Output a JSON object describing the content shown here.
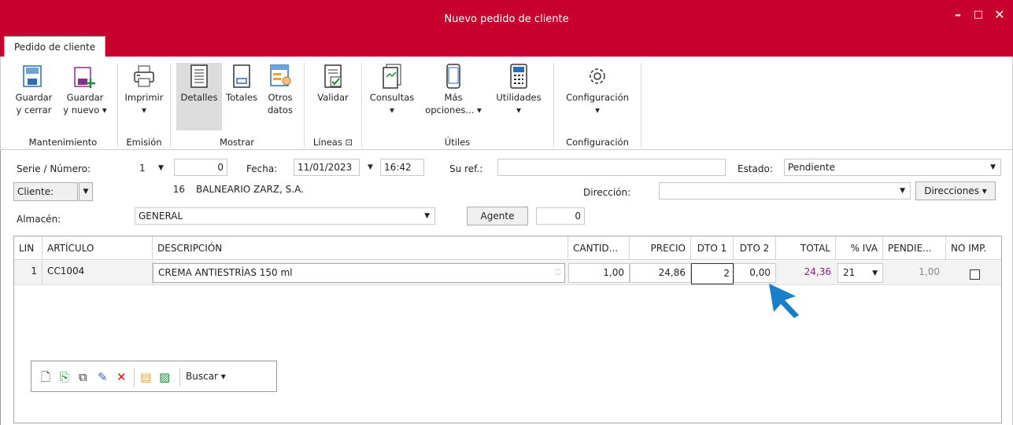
{
  "window": {
    "title": "Nuevo pedido de cliente",
    "minimize": "–",
    "maximize": "□",
    "close": "✕"
  },
  "tab": {
    "label": "Pedido de cliente"
  },
  "ribbon": {
    "guardar_cerrar": [
      "Guardar",
      "y cerrar"
    ],
    "guardar_nuevo": [
      "Guardar",
      "y nuevo ▾"
    ],
    "imprimir": [
      "Imprimir",
      "▾"
    ],
    "detalles": "Detalles",
    "totales": "Totales",
    "otros": [
      "Otros",
      "datos"
    ],
    "validar": "Validar",
    "consultas": [
      "Consultas",
      "▾"
    ],
    "mas": [
      "Más",
      "opciones... ▾"
    ],
    "utilidades": [
      "Utilidades",
      "▾"
    ],
    "configuracion": [
      "Configuración",
      "▾"
    ],
    "groups": {
      "mantenimiento": "Mantenimiento",
      "emision": "Emisión",
      "mostrar": "Mostrar",
      "lineas": "Líneas ⊡",
      "utiles": "Útiles",
      "configuracion": "Configuración"
    }
  },
  "form": {
    "serie_label": "Serie / Número:",
    "serie_value": "1",
    "numero_value": "0",
    "fecha_label": "Fecha:",
    "fecha_value": "11/01/2023",
    "hora_value": "16:42",
    "suref_label": "Su ref.:",
    "suref_value": "",
    "estado_label": "Estado:",
    "estado_value": "Pendiente",
    "cliente_label": "Cliente:",
    "cliente_code": "16",
    "cliente_name": "BALNEARIO ZARZ, S.A.",
    "direccion_label": "Dirección:",
    "direccion_value": "",
    "direcciones_btn": "Direcciones ▾",
    "almacen_label": "Almacén:",
    "almacen_value": "GENERAL",
    "agente_btn": "Agente",
    "agente_value": "0"
  },
  "grid": {
    "headers": [
      "LIN",
      "ARTÍCULO",
      "DESCRIPCIÓN",
      "CANTID...",
      "PRECIO",
      "DTO 1",
      "DTO 2",
      "TOTAL",
      "% IVA",
      "PENDIE...",
      "NO IMP."
    ],
    "row": {
      "lin": "1",
      "articulo": "CC1004",
      "descripcion": "CREMA ANTIESTRÍAS 150 ml",
      "cantidad": "1,00",
      "precio": "24,86",
      "dto1": "2",
      "dto2": "0,00",
      "total": "24,36",
      "iva": "21",
      "pendiente": "1,00"
    }
  },
  "linetoolbar": {
    "buscar": "Buscar ▾"
  },
  "colors": {
    "brand": "#c8002d",
    "accent_arrow": "#1a7fcb",
    "total_text": "#8e1f8e"
  }
}
